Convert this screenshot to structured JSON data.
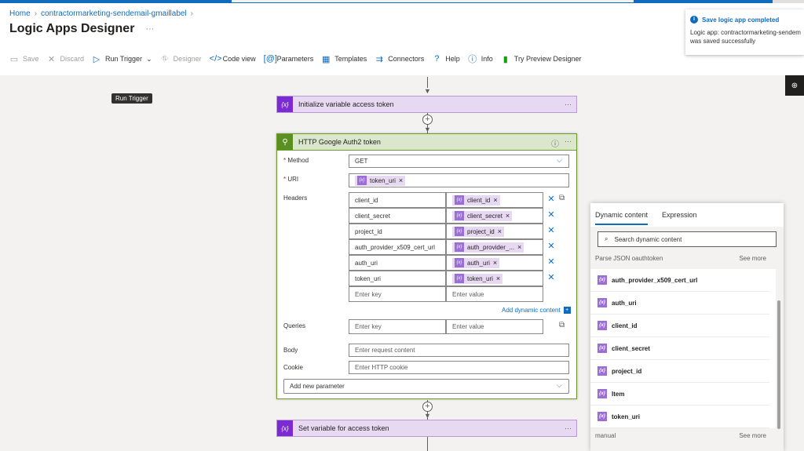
{
  "breadcrumb": {
    "home": "Home",
    "resource": "contractormarketing-sendemail-gmaillabel"
  },
  "page": {
    "title": "Logic Apps Designer",
    "more": "···"
  },
  "toolbar": {
    "save": "Save",
    "discard": "Discard",
    "run_trigger": "Run Trigger",
    "designer": "Designer",
    "code_view": "Code view",
    "parameters": "Parameters",
    "templates": "Templates",
    "connectors": "Connectors",
    "help": "Help",
    "info": "Info",
    "try_preview": "Try Preview Designer"
  },
  "tooltip": "Run Trigger",
  "steps": {
    "init_var": {
      "title": "Initialize variable access token",
      "icon": "{x}",
      "more": "···"
    },
    "set_var": {
      "title": "Set variable for access token",
      "icon": "{x}",
      "more": "···"
    }
  },
  "http": {
    "title": "HTTP Google Auth2 token",
    "more": "···",
    "method_label": "Method",
    "method_value": "GET",
    "uri_label": "URI",
    "uri_token": "token_uri",
    "headers_label": "Headers",
    "headers": [
      {
        "key": "client_id",
        "value": "client_id"
      },
      {
        "key": "client_secret",
        "value": "client_secret"
      },
      {
        "key": "project_id",
        "value": "project_id"
      },
      {
        "key": "auth_provider_x509_cert_url",
        "value": "auth_provider_..."
      },
      {
        "key": "auth_uri",
        "value": "auth_uri"
      },
      {
        "key": "token_uri",
        "value": "token_uri"
      }
    ],
    "enter_key": "Enter key",
    "enter_value": "Enter value",
    "add_dynamic": "Add dynamic content",
    "queries_label": "Queries",
    "body_label": "Body",
    "body_placeholder": "Enter request content",
    "cookie_label": "Cookie",
    "cookie_placeholder": "Enter HTTP cookie",
    "add_param": "Add new parameter"
  },
  "dynamic": {
    "tab_dynamic": "Dynamic content",
    "tab_expression": "Expression",
    "search_placeholder": "Search dynamic content",
    "section1": "Parse JSON oauthtoken",
    "see_more": "See more",
    "items": [
      "auth_provider_x509_cert_url",
      "auth_uri",
      "client_id",
      "client_secret",
      "project_id",
      "Item",
      "token_uri"
    ],
    "section2": "manual",
    "see_more2": "See more"
  },
  "toast": {
    "title": "Save logic app completed",
    "line1": "Logic app: contractormarketing-sendem",
    "line2": "was saved successfully"
  },
  "colors": {
    "accent": "#0f6cbd",
    "variable": "#7b2bd1",
    "http": "#5a8f21"
  }
}
